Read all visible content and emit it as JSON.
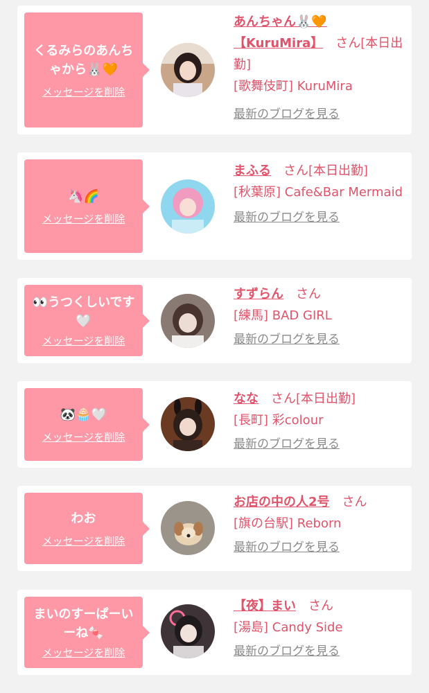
{
  "delete_label": "メッセージを削除",
  "blog_label": "最新のブログを見る",
  "san_label": "さん",
  "working_label": "[本日出勤]",
  "accent_color": "#e0536a",
  "bubble_color": "#fe98a7",
  "cards": [
    {
      "message": "くるみらのあんちゃから🐰🧡",
      "name": "あんちゃん🐰🧡【KuruMira】",
      "working": "[本日出勤]",
      "shop": "[歌舞伎町] KuruMira",
      "avatar_icon": "girl-photo"
    },
    {
      "message": "🦄🌈",
      "name": "まふる",
      "working": "[本日出勤]",
      "shop": "[秋葉原] Cafe&Bar Mermaid",
      "avatar_icon": "girl-photo"
    },
    {
      "message": "👀うつくしいです🤍",
      "name": "すずらん",
      "working": "",
      "shop": "[練馬] BAD GIRL",
      "avatar_icon": "girl-photo"
    },
    {
      "message": "🐼🧁🤍",
      "name": "なな",
      "working": "[本日出勤]",
      "shop": "[長町] 彩colour",
      "avatar_icon": "girl-photo"
    },
    {
      "message": "わお",
      "name": "お店の中の人2号",
      "working": "",
      "shop": "[旗の台駅] Reborn",
      "avatar_icon": "dog-photo"
    },
    {
      "message": "まいのすーぱーいーね🍬",
      "name": "【夜】まい",
      "working": "",
      "shop": "[湯島] Candy Side",
      "avatar_icon": "girl-photo"
    }
  ]
}
